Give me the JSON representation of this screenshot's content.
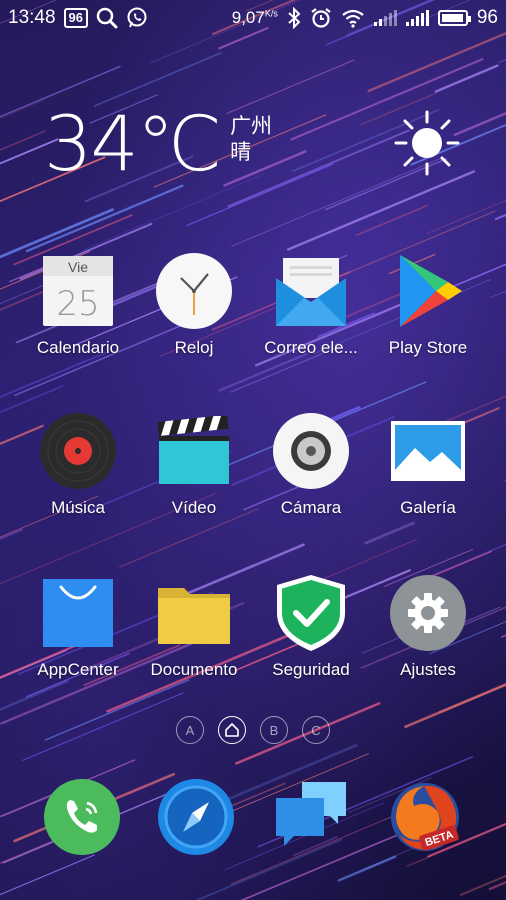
{
  "status_bar": {
    "time": "13:48",
    "notification_badge": "96",
    "net_speed": "9,07",
    "net_speed_unit": "K/s",
    "battery": "96",
    "battery_fraction": 0.96,
    "icons": [
      "search-icon",
      "whatsapp-icon",
      "bluetooth-icon",
      "alarm-icon",
      "wifi-icon",
      "signal-icon",
      "signal-icon",
      "battery-icon"
    ]
  },
  "weather": {
    "temperature": "34℃",
    "city": "广州",
    "condition": "晴",
    "icon": "sun-icon"
  },
  "apps": [
    {
      "label": "Calendario",
      "icon": "calendar-icon",
      "day": "Vie",
      "date": "25"
    },
    {
      "label": "Reloj",
      "icon": "clock-icon"
    },
    {
      "label": "Correo ele...",
      "icon": "mail-icon"
    },
    {
      "label": "Play Store",
      "icon": "play-store-icon"
    },
    {
      "label": "Música",
      "icon": "music-icon"
    },
    {
      "label": "Vídeo",
      "icon": "video-icon"
    },
    {
      "label": "Cámara",
      "icon": "camera-icon"
    },
    {
      "label": "Galería",
      "icon": "gallery-icon"
    },
    {
      "label": "AppCenter",
      "icon": "appcenter-icon"
    },
    {
      "label": "Documento",
      "icon": "folder-icon"
    },
    {
      "label": "Seguridad",
      "icon": "shield-icon"
    },
    {
      "label": "Ajustes",
      "icon": "settings-icon"
    }
  ],
  "pager": [
    "A",
    "home",
    "B",
    "C"
  ],
  "dock": [
    {
      "icon": "phone-icon"
    },
    {
      "icon": "browser-icon"
    },
    {
      "icon": "messages-icon"
    },
    {
      "icon": "firefox-beta-icon",
      "badge": "BETA"
    }
  ],
  "colors": {
    "background": "#241a5a",
    "phone_green": "#4cbb5e",
    "browser_blue": "#1e88e5",
    "shield_green": "#1db35c",
    "settings_gray": "#8e9398"
  }
}
